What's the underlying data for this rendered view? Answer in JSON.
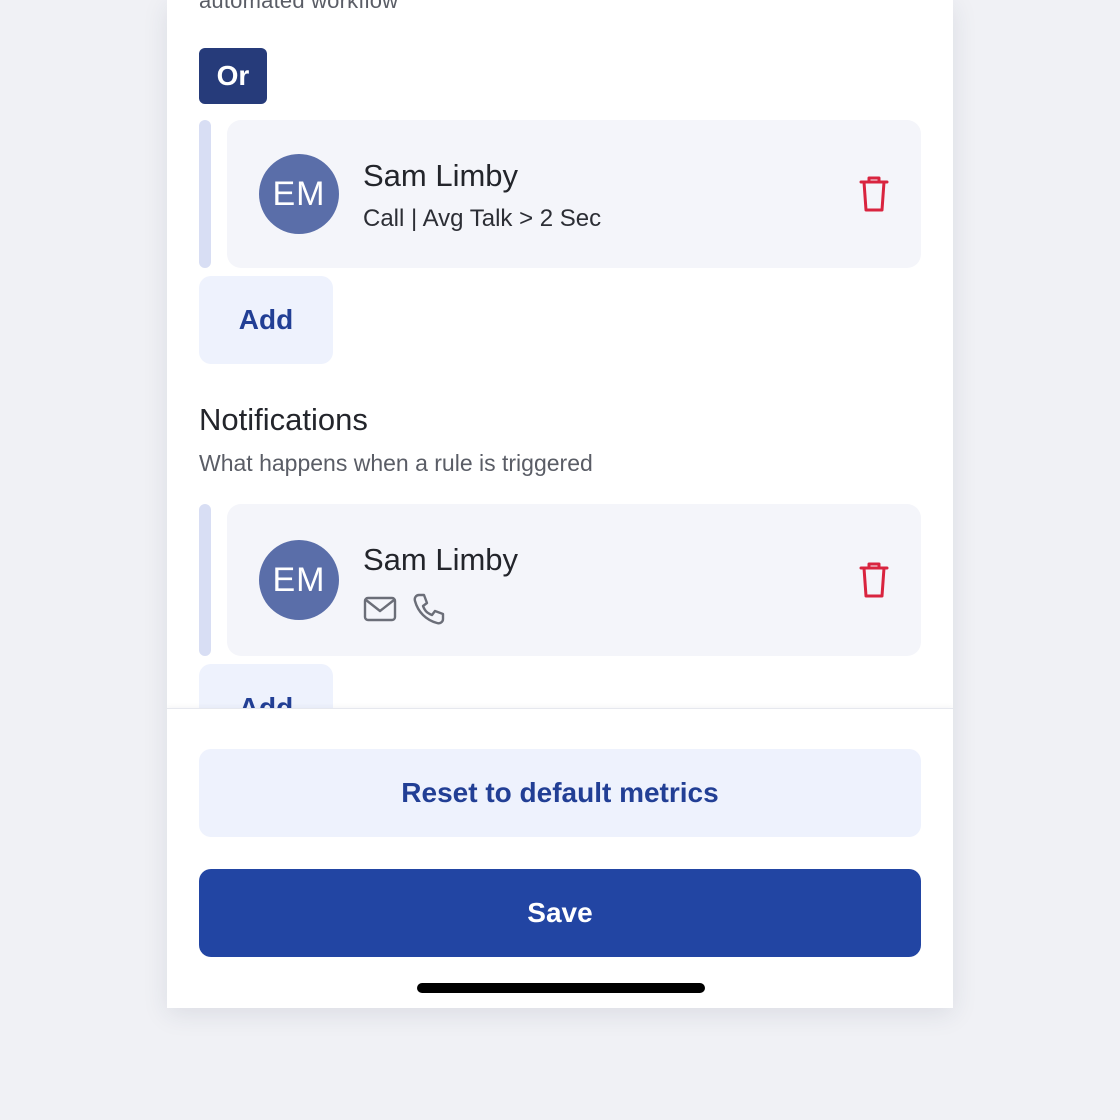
{
  "conditions": {
    "caption": "automated workflow",
    "operator_label": "Or",
    "rule": {
      "avatar_initials": "EM",
      "name": "Sam Limby",
      "detail": "Call | Avg Talk > 2 Sec",
      "delete_icon": "trash-icon"
    },
    "add_label": "Add"
  },
  "notifications": {
    "title": "Notifications",
    "subtitle": "What happens when a rule is triggered",
    "rule": {
      "avatar_initials": "EM",
      "name": "Sam Limby",
      "channel_icons": [
        "mail-icon",
        "phone-icon"
      ],
      "delete_icon": "trash-icon"
    },
    "add_label": "Add"
  },
  "footer": {
    "reset_label": "Reset to default metrics",
    "save_label": "Save"
  },
  "colors": {
    "primary": "#2245a3",
    "operator_badge": "#263b7a",
    "avatar": "#5a6ea9",
    "danger": "#d9243f",
    "secondary_button_bg": "#eef2fd",
    "card_bg": "#f4f5fa"
  }
}
